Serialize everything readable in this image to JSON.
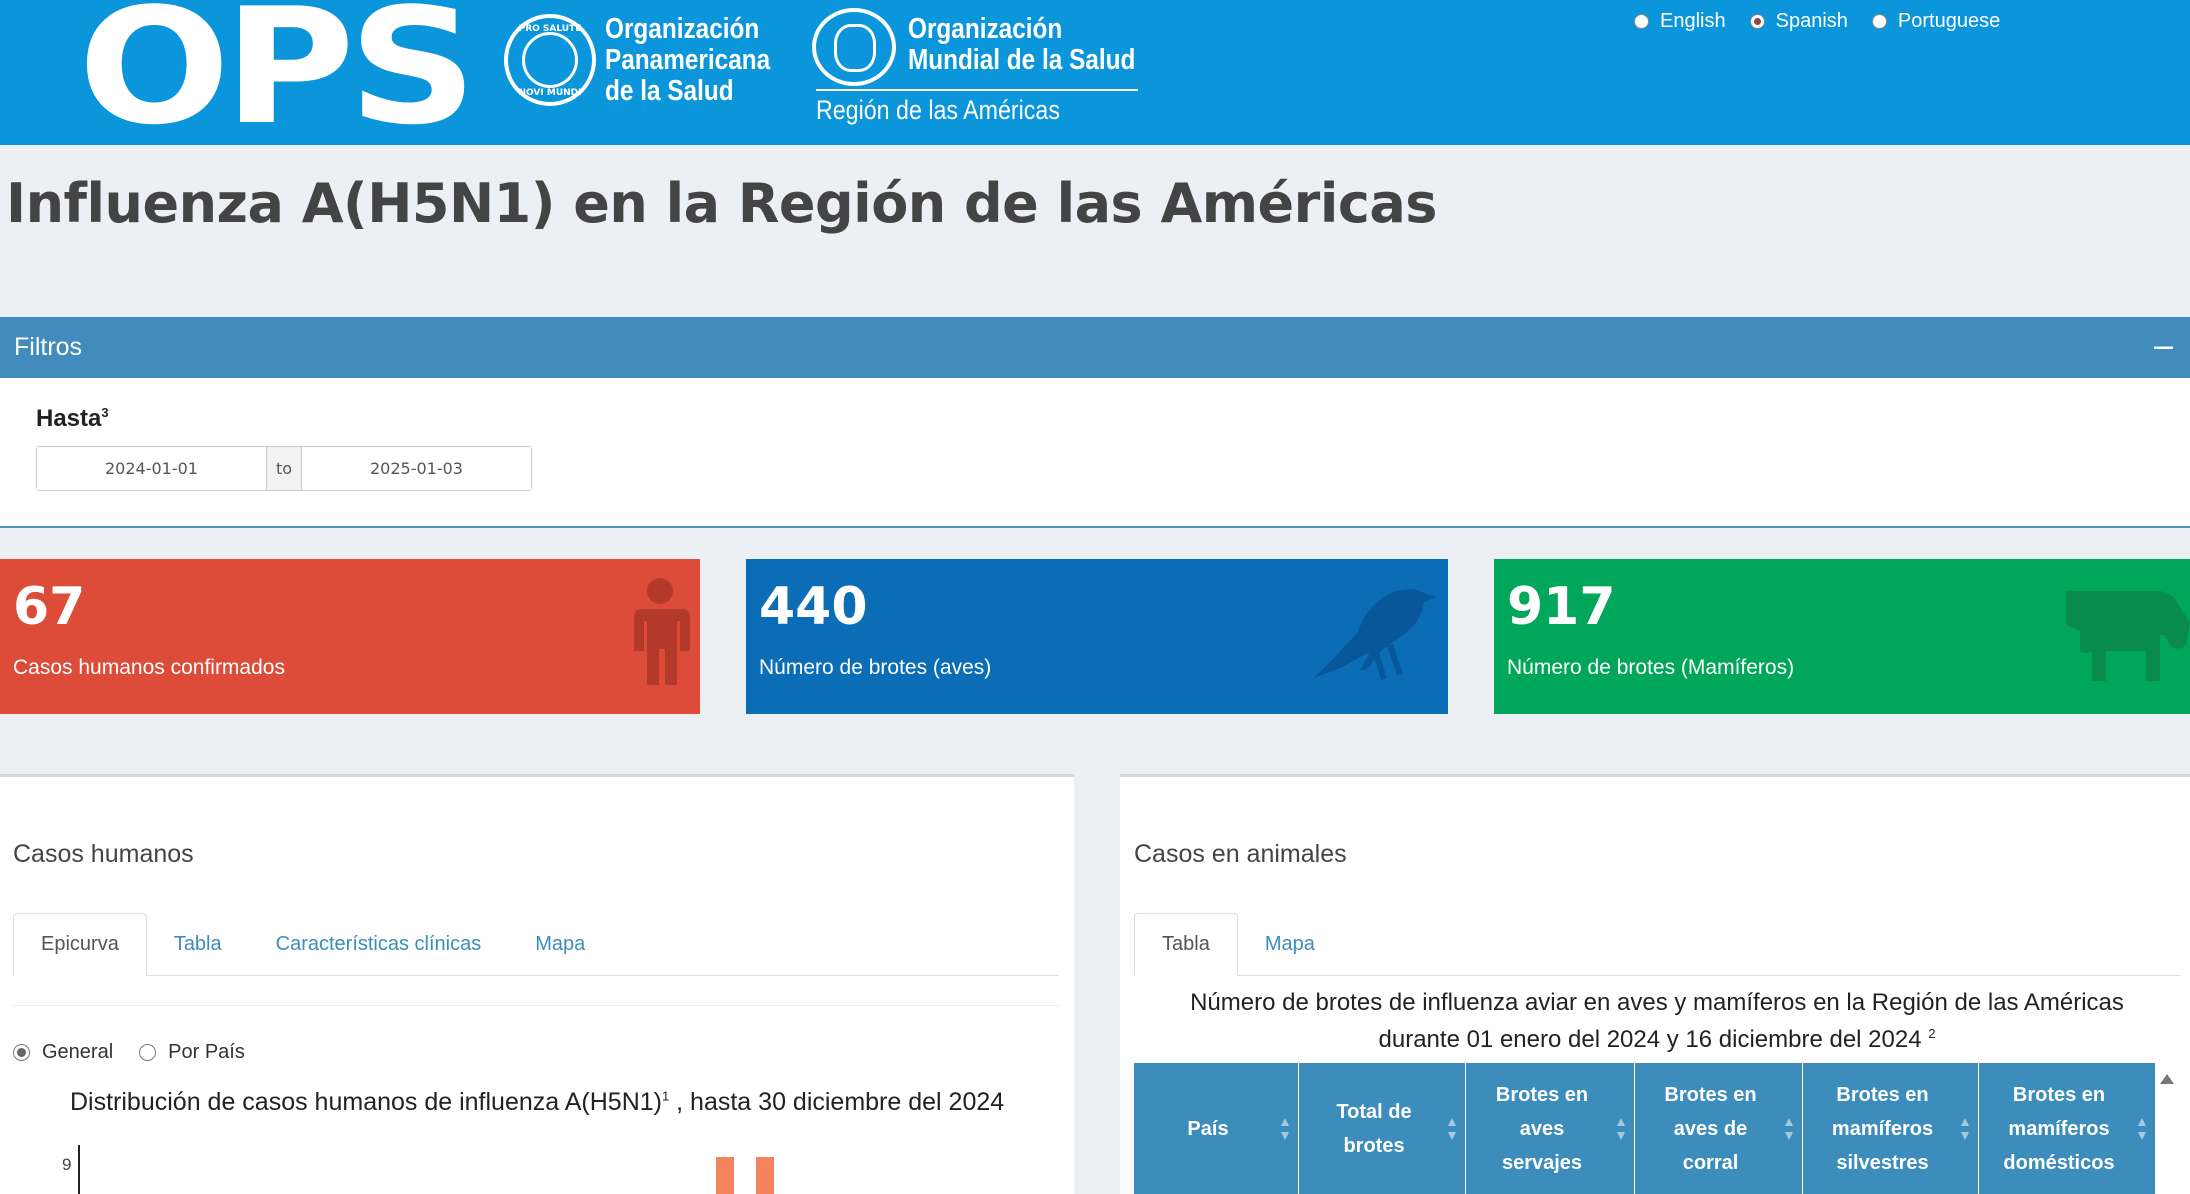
{
  "header": {
    "logo_text": "OPS",
    "paho_seal_top": "PRO SALUTE",
    "paho_seal_bottom": "NOVI MUNDI",
    "paho_name": [
      "Organización",
      "Panamericana",
      "de la Salud"
    ],
    "who_name": [
      "Organización",
      "Mundial de la Salud"
    ],
    "who_region": "Región de las Américas",
    "languages": [
      {
        "label": "English",
        "selected": false
      },
      {
        "label": "Spanish",
        "selected": true
      },
      {
        "label": "Portuguese",
        "selected": false
      }
    ]
  },
  "page_title": "Influenza A(H5N1) en la Región de las Américas",
  "filters": {
    "title": "Filtros",
    "collapse_symbol": "−",
    "hasta_label": "Hasta",
    "hasta_sup": "3",
    "date_from": "2024-01-01",
    "date_to": "2025-01-03",
    "separator": "to"
  },
  "kpis": [
    {
      "value": "67",
      "label": "Casos humanos confirmados",
      "color": "#dd4b39",
      "icon_color": "#b33a2b",
      "icon": "person-icon"
    },
    {
      "value": "440",
      "label": "Número de brotes (aves)",
      "color": "#0a6db5",
      "icon_color": "#08579a",
      "icon": "bird-icon"
    },
    {
      "value": "917",
      "label": "Número de brotes (Mamíferos)",
      "color": "#00a65a",
      "icon_color": "#088b4b",
      "icon": "cow-icon"
    }
  ],
  "human_panel": {
    "title": "Casos humanos",
    "tabs": [
      {
        "label": "Epicurva",
        "active": true
      },
      {
        "label": "Tabla",
        "active": false
      },
      {
        "label": "Características clínicas",
        "active": false
      },
      {
        "label": "Mapa",
        "active": false
      }
    ],
    "radio_options": [
      {
        "label": "General",
        "selected": true
      },
      {
        "label": "Por País",
        "selected": false
      }
    ],
    "chart_title": "Distribución de casos humanos de influenza A(H5N1)",
    "chart_title_sup": "1",
    "chart_title_suffix": " , hasta 30 diciembre del 2024",
    "chart_data": {
      "type": "bar",
      "title": "Distribución de casos humanos de influenza A(H5N1), hasta 30 diciembre del 2024",
      "y_tick_visible": "9",
      "bar_color": "#f4845f"
    }
  },
  "animal_panel": {
    "title": "Casos en animales",
    "tabs": [
      {
        "label": "Tabla",
        "active": true
      },
      {
        "label": "Mapa",
        "active": false
      }
    ],
    "caption_line1": "Número de brotes de influenza aviar en aves y mamíferos en la Región de las Américas",
    "caption_line2": "durante 01 enero del 2024 y 16 diciembre del 2024",
    "caption_sup": "2",
    "columns": [
      [
        "País"
      ],
      [
        "Total de",
        "brotes"
      ],
      [
        "Brotes en",
        "aves",
        "servajes"
      ],
      [
        "Brotes en",
        "aves de",
        "corral"
      ],
      [
        "Brotes en",
        "mamíferos",
        "silvestres"
      ],
      [
        "Brotes en",
        "mamíferos",
        "domésticos"
      ]
    ]
  }
}
